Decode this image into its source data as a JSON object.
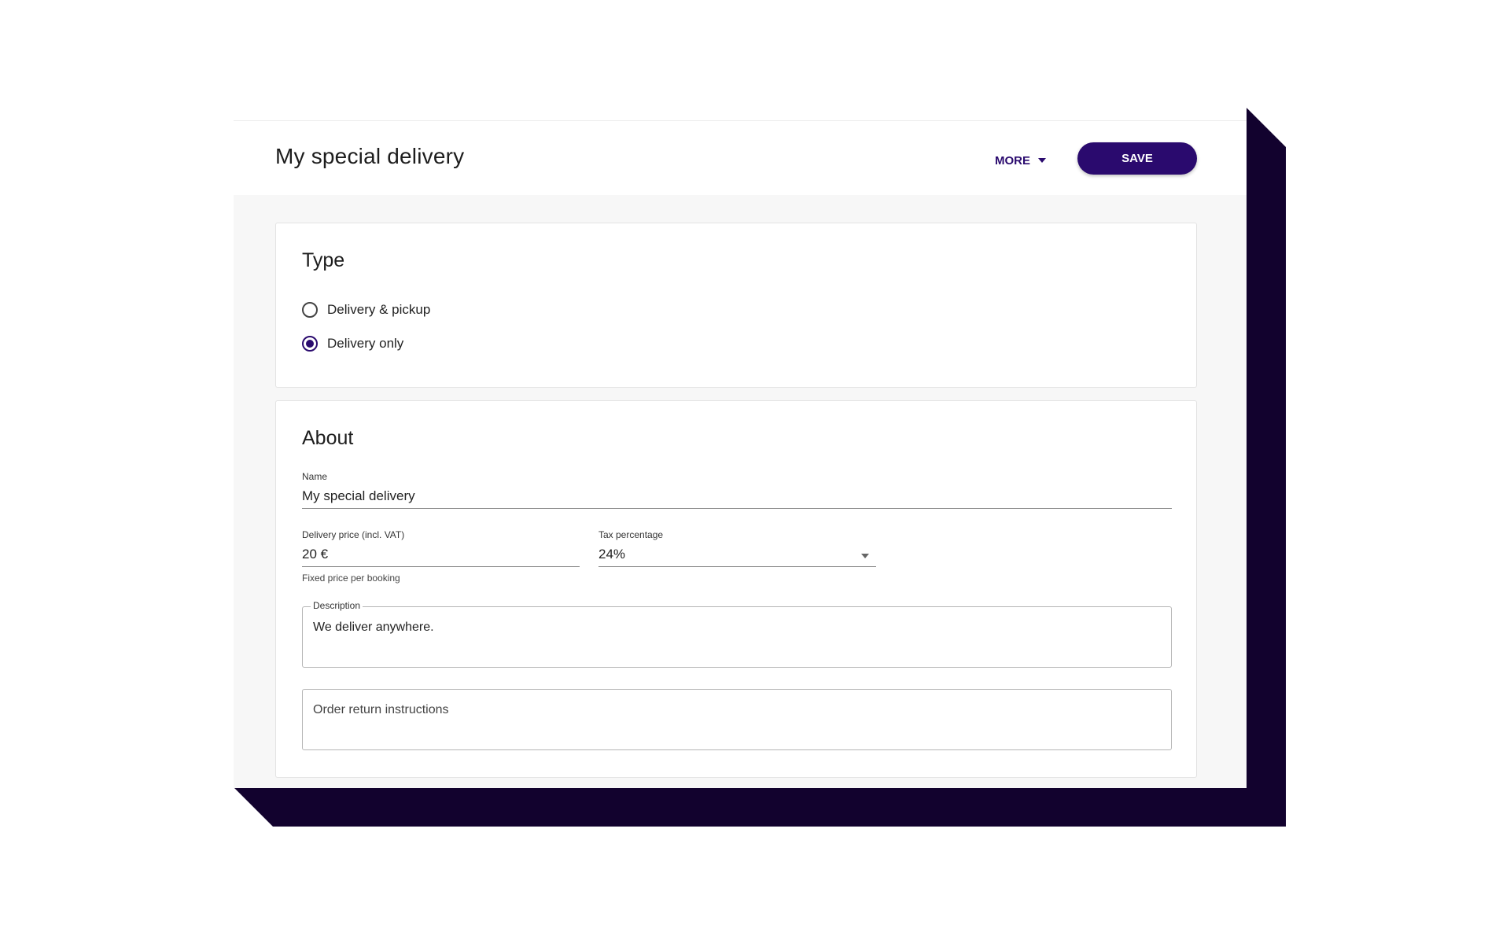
{
  "header": {
    "title": "My special delivery",
    "more_label": "MORE",
    "save_label": "SAVE"
  },
  "type_section": {
    "title": "Type",
    "options": [
      {
        "label": "Delivery & pickup",
        "selected": false
      },
      {
        "label": "Delivery only",
        "selected": true
      }
    ]
  },
  "about_section": {
    "title": "About",
    "name": {
      "label": "Name",
      "value": "My special delivery"
    },
    "price": {
      "label": "Delivery price (incl. VAT)",
      "value": "20 €",
      "helper": "Fixed price per booking"
    },
    "tax": {
      "label": "Tax percentage",
      "value": "24%"
    },
    "description": {
      "label": "Description",
      "value": "We deliver anywhere."
    },
    "return_instructions": {
      "placeholder": "Order return instructions"
    }
  },
  "colors": {
    "accent": "#2a0a6e",
    "slab": "#12022e",
    "background": "#f7f7f7"
  }
}
